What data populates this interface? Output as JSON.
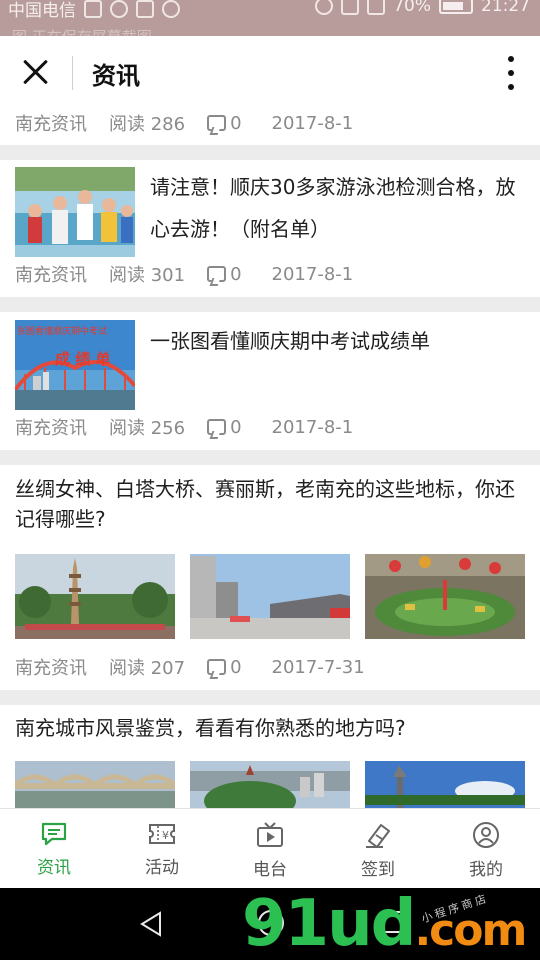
{
  "status_bar": {
    "carrier": "中国电信",
    "battery": "70%",
    "time": "21:27",
    "overlay_text": "图  正在保存屏幕截图"
  },
  "header": {
    "title": "资讯"
  },
  "top_meta": {
    "source": "南充资讯",
    "reads": "阅读 286",
    "comments": "0",
    "date": "2017-8-1"
  },
  "articles": [
    {
      "title": "请注意！顺庆30多家游泳池检测合格，放心去游！（附名单）",
      "source": "南充资讯",
      "reads": "阅读 301",
      "comments": "0",
      "date": "2017-8-1"
    },
    {
      "title": "一张图看懂顺庆期中考试成绩单",
      "thumb_text_top": "张图看懂顺庆期中考试",
      "thumb_text_main": "成 绩 单",
      "source": "南充资讯",
      "reads": "阅读 256",
      "comments": "0",
      "date": "2017-8-1"
    },
    {
      "title": "丝绸女神、白塔大桥、赛丽斯，老南充的这些地标，你还记得哪些?",
      "source": "南充资讯",
      "reads": "阅读 207",
      "comments": "0",
      "date": "2017-7-31"
    },
    {
      "title": "南充城市风景鉴赏，看看有你熟悉的地方吗?"
    }
  ],
  "tabs": [
    {
      "label": "资讯",
      "icon": "chat-icon",
      "active": true
    },
    {
      "label": "活动",
      "icon": "ticket-icon",
      "active": false
    },
    {
      "label": "电台",
      "icon": "tv-icon",
      "active": false
    },
    {
      "label": "签到",
      "icon": "signin-icon",
      "active": false
    },
    {
      "label": "我的",
      "icon": "user-icon",
      "active": false
    }
  ],
  "watermark": {
    "main": "91ud",
    "suffix": ".com",
    "caption": "小程序商店"
  },
  "colors": {
    "accent": "#2ba245",
    "meta": "#8a8a8a",
    "separator": "#ececec",
    "status_bar": "#b89c9b"
  }
}
